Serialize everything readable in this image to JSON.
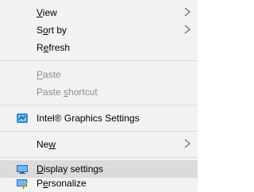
{
  "context_menu": {
    "view": {
      "pre": "",
      "mnemonic": "V",
      "post": "iew"
    },
    "sort_by": {
      "pre": "S",
      "mnemonic": "o",
      "post": "rt by"
    },
    "refresh": {
      "pre": "R",
      "mnemonic": "e",
      "post": "fresh"
    },
    "paste": {
      "pre": "",
      "mnemonic": "P",
      "post": "aste"
    },
    "paste_shortcut": {
      "pre": "Paste ",
      "mnemonic": "s",
      "post": "hortcut"
    },
    "intel_graphics": {
      "label": "Intel® Graphics Settings",
      "icon": "intel-graphics-icon"
    },
    "new": {
      "pre": "Ne",
      "mnemonic": "w",
      "post": ""
    },
    "display_settings": {
      "pre": "",
      "mnemonic": "D",
      "post": "isplay settings",
      "icon": "display-icon"
    },
    "personalize": {
      "pre": "P",
      "mnemonic": "e",
      "post": "rsonalize",
      "icon": "personalize-icon"
    }
  },
  "colors": {
    "menu_bg": "#f2f2f2",
    "highlight_bg": "#dbdbdb",
    "disabled_text": "#8d8d8d",
    "separator": "#d9d9d9"
  }
}
